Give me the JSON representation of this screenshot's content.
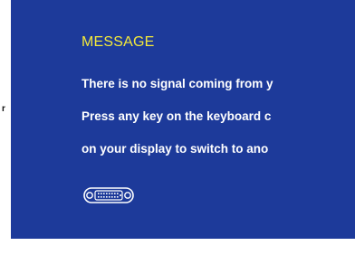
{
  "side_fragment": {
    "text": "r"
  },
  "osd": {
    "title": "MESSAGE",
    "lines": [
      "There is no signal coming from y",
      "Press any key on the keyboard c",
      "on your display to switch to ano"
    ],
    "connector_icon": "dvi-connector-icon",
    "colors": {
      "background": "#1d3a9a",
      "title": "#f4e93a",
      "text": "#ffffff"
    }
  }
}
